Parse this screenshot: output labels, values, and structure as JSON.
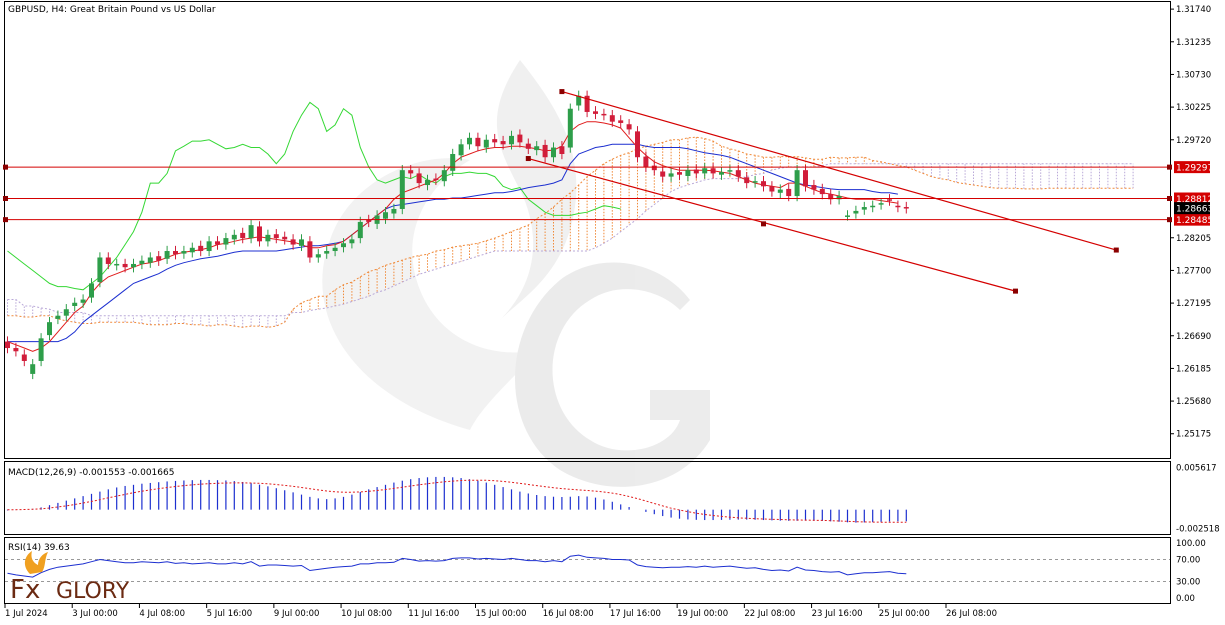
{
  "header": {
    "title": "GBPUSD, H4:  Great Britain Pound vs US Dollar"
  },
  "colors": {
    "bull": "#2e9e4a",
    "bear": "#d11d3a",
    "tenkan": "#e01c1c",
    "kijun": "#1c2fd0",
    "chikou": "#35d835",
    "cloud_a": "#f08a3a",
    "cloud_b": "#b9a8d8",
    "level_line": "#d40000",
    "macd_hist": "#1c2fd0",
    "macd_signal": "#e01c1c",
    "rsi_line": "#1c2fd0",
    "watermark": "#d4d4d4",
    "grid_text": "#000000"
  },
  "chart_data": {
    "type": "candlestick",
    "symbol": "GBPUSD",
    "timeframe": "H4",
    "ylim": [
      1.248,
      1.3185
    ],
    "yticks": [
      {
        "value": 1.3174,
        "label": "1.31740"
      },
      {
        "value": 1.31235,
        "label": "1.31235"
      },
      {
        "value": 1.3073,
        "label": "1.30730"
      },
      {
        "value": 1.30225,
        "label": "1.30225"
      },
      {
        "value": 1.2972,
        "label": "1.29720"
      },
      {
        "value": 1.28205,
        "label": "1.28205"
      },
      {
        "value": 1.277,
        "label": "1.27700"
      },
      {
        "value": 1.27195,
        "label": "1.27195"
      },
      {
        "value": 1.2669,
        "label": "1.26690"
      },
      {
        "value": 1.26185,
        "label": "1.26185"
      },
      {
        "value": 1.2568,
        "label": "1.25680"
      },
      {
        "value": 1.25175,
        "label": "1.25175"
      }
    ],
    "levels": [
      {
        "value": 1.29297,
        "label": "1.29297"
      },
      {
        "value": 1.28812,
        "label": "1.28812"
      },
      {
        "value": 1.28485,
        "label": "1.28485"
      }
    ],
    "current_price": {
      "value": 1.28663,
      "label": "1.28663"
    },
    "xticks": [
      "1 Jul 2024",
      "3 Jul 00:00",
      "4 Jul 08:00",
      "5 Jul 16:00",
      "9 Jul 00:00",
      "10 Jul 08:00",
      "11 Jul 16:00",
      "15 Jul 00:00",
      "16 Jul 08:00",
      "17 Jul 16:00",
      "19 Jul 00:00",
      "22 Jul 08:00",
      "23 Jul 16:00",
      "25 Jul 00:00",
      "26 Jul 08:00"
    ],
    "closes": [
      1.265,
      1.2645,
      1.263,
      1.2625,
      1.2665,
      1.269,
      1.27,
      1.271,
      1.272,
      1.2725,
      1.275,
      1.279,
      1.278,
      1.278,
      1.2775,
      1.278,
      1.2785,
      1.279,
      1.2785,
      1.28,
      1.2795,
      1.28,
      1.2805,
      1.28,
      1.2815,
      1.281,
      1.282,
      1.2825,
      1.282,
      1.284,
      1.2815,
      1.2825,
      1.282,
      1.2818,
      1.281,
      1.2818,
      1.279,
      1.2795,
      1.28,
      1.2805,
      1.2812,
      1.2818,
      1.2845,
      1.2845,
      1.2855,
      1.286,
      1.2865,
      1.2925,
      1.292,
      1.2905,
      1.291,
      1.291,
      1.2925,
      1.295,
      1.2965,
      1.2975,
      1.2962,
      1.2972,
      1.2968,
      1.2965,
      1.2978,
      1.2968,
      1.2958,
      1.2962,
      1.2945,
      1.296,
      1.295,
      1.302,
      1.304,
      1.3015,
      1.3012,
      1.301,
      1.3,
      1.2998,
      1.2988,
      1.2945,
      1.293,
      1.2925,
      1.2915,
      1.292,
      1.2918,
      1.2925,
      1.292,
      1.2928,
      1.292,
      1.2922,
      1.2925,
      1.2915,
      1.2905,
      1.2908,
      1.29,
      1.2892,
      1.2895,
      1.2885,
      1.2925,
      1.29,
      1.2895,
      1.2888,
      1.288,
      1.2885,
      1.2855,
      1.2862,
      1.2868,
      1.287,
      1.2874,
      1.2878,
      1.2868,
      1.2866
    ],
    "opens": [
      1.266,
      1.265,
      1.264,
      1.261,
      1.263,
      1.267,
      1.2695,
      1.27,
      1.2715,
      1.272,
      1.2728,
      1.2752,
      1.279,
      1.2778,
      1.278,
      1.2775,
      1.278,
      1.2782,
      1.2792,
      1.2788,
      1.28,
      1.2796,
      1.2798,
      1.2808,
      1.28,
      1.2815,
      1.281,
      1.2818,
      1.2828,
      1.282,
      1.2838,
      1.2815,
      1.2826,
      1.2822,
      1.2818,
      1.2808,
      1.2815,
      1.279,
      1.2796,
      1.28,
      1.2806,
      1.2812,
      1.282,
      1.2848,
      1.2842,
      1.285,
      1.2858,
      1.2865,
      1.2925,
      1.292,
      1.2902,
      1.2912,
      1.2908,
      1.2924,
      1.2948,
      1.2965,
      1.2975,
      1.296,
      1.2973,
      1.297,
      1.2965,
      1.298,
      1.2966,
      1.2956,
      1.2964,
      1.2945,
      1.2962,
      1.296,
      1.3025,
      1.304,
      1.3016,
      1.3012,
      1.301,
      1.3002,
      1.2996,
      1.2985,
      1.2946,
      1.2932,
      1.2923,
      1.2915,
      1.2922,
      1.2916,
      1.2926,
      1.292,
      1.2928,
      1.2918,
      1.2924,
      1.2925,
      1.2914,
      1.2906,
      1.2908,
      1.29,
      1.289,
      1.2896,
      1.2885,
      1.2925,
      1.2902,
      1.2896,
      1.2888,
      1.288,
      1.2855,
      1.2858,
      1.2864,
      1.2868,
      1.2872,
      1.288,
      1.287,
      1.2868
    ],
    "tenkan": [
      1.266,
      1.2655,
      1.265,
      1.2645,
      1.265,
      1.266,
      1.2675,
      1.269,
      1.2705,
      1.2715,
      1.2735,
      1.275,
      1.276,
      1.2765,
      1.277,
      1.2775,
      1.278,
      1.2782,
      1.2785,
      1.279,
      1.2795,
      1.2798,
      1.28,
      1.2802,
      1.2805,
      1.281,
      1.2812,
      1.2815,
      1.2818,
      1.282,
      1.2822,
      1.282,
      1.2818,
      1.2816,
      1.2814,
      1.281,
      1.2805,
      1.2805,
      1.2808,
      1.281,
      1.2815,
      1.2825,
      1.2835,
      1.2845,
      1.2855,
      1.2865,
      1.288,
      1.289,
      1.2895,
      1.29,
      1.2905,
      1.291,
      1.292,
      1.2935,
      1.2945,
      1.295,
      1.2955,
      1.2958,
      1.296,
      1.296,
      1.2962,
      1.2962,
      1.296,
      1.2958,
      1.2955,
      1.2956,
      1.2962,
      1.2985,
      1.2995,
      1.3,
      1.3,
      1.2998,
      1.2995,
      1.299,
      1.2975,
      1.296,
      1.2948,
      1.2938,
      1.2932,
      1.2928,
      1.2925,
      1.2925,
      1.2925,
      1.2925,
      1.2924,
      1.2922,
      1.292,
      1.2915,
      1.291,
      1.2905,
      1.2902,
      1.29,
      1.2898,
      1.2905,
      1.2905,
      1.29,
      1.2895,
      1.289,
      1.2888,
      1.2885,
      1.2882,
      1.288,
      1.288,
      1.288,
      1.2878,
      1.2876,
      1.2874
    ],
    "kijun": [
      1.266,
      1.266,
      1.266,
      1.266,
      1.266,
      1.266,
      1.266,
      1.2665,
      1.2675,
      1.269,
      1.27,
      1.271,
      1.272,
      1.273,
      1.274,
      1.275,
      1.2755,
      1.276,
      1.2765,
      1.2772,
      1.2778,
      1.2782,
      1.2785,
      1.2788,
      1.279,
      1.2792,
      1.2795,
      1.2798,
      1.28,
      1.28,
      1.28,
      1.28,
      1.28,
      1.2802,
      1.2804,
      1.2806,
      1.2808,
      1.2808,
      1.281,
      1.2812,
      1.2815,
      1.2825,
      1.2835,
      1.2845,
      1.2855,
      1.2865,
      1.287,
      1.2872,
      1.2874,
      1.2876,
      1.2878,
      1.288,
      1.288,
      1.2882,
      1.2882,
      1.2884,
      1.2886,
      1.2888,
      1.289,
      1.289,
      1.2892,
      1.2895,
      1.2898,
      1.29,
      1.2902,
      1.2905,
      1.291,
      1.2935,
      1.295,
      1.2955,
      1.296,
      1.2962,
      1.2965,
      1.2965,
      1.2965,
      1.2965,
      1.2962,
      1.296,
      1.296,
      1.296,
      1.296,
      1.2958,
      1.2955,
      1.2952,
      1.295,
      1.2948,
      1.2945,
      1.294,
      1.2935,
      1.293,
      1.2925,
      1.292,
      1.2915,
      1.291,
      1.2905,
      1.2902,
      1.29,
      1.2898,
      1.2896,
      1.2895,
      1.2895,
      1.2895,
      1.2895,
      1.2892,
      1.289,
      1.289,
      1.2888
    ],
    "chikou": [
      1.28,
      1.279,
      1.278,
      1.277,
      1.276,
      1.275,
      1.2745,
      1.2745,
      1.2742,
      1.274,
      1.275,
      1.276,
      1.2775,
      1.279,
      1.281,
      1.283,
      1.286,
      1.2905,
      1.2905,
      1.292,
      1.2955,
      1.2962,
      1.297,
      1.297,
      1.2972,
      1.2965,
      1.2958,
      1.296,
      1.2965,
      1.296,
      1.296,
      1.295,
      1.2935,
      1.295,
      1.2985,
      1.301,
      1.303,
      1.302,
      1.2985,
      1.2995,
      1.302,
      1.301,
      1.296,
      1.293,
      1.291,
      1.2905,
      1.291,
      1.2915,
      1.2912,
      1.2918,
      1.291,
      1.2905,
      1.2915,
      1.292,
      1.292,
      1.2922,
      1.292,
      1.292,
      1.2915,
      1.29,
      1.2895,
      1.2898,
      1.288,
      1.287,
      1.286,
      1.2855,
      1.2855,
      1.2855,
      1.2858,
      1.286,
      1.2865,
      1.287,
      1.2868,
      1.2865
    ],
    "span_a": [
      1.27,
      1.27,
      1.2698,
      1.2698,
      1.27,
      1.27,
      1.2695,
      1.2692,
      1.269,
      1.2688,
      1.2688,
      1.269,
      1.269,
      1.269,
      1.269,
      1.269,
      1.2688,
      1.2686,
      1.2686,
      1.2686,
      1.2688,
      1.2688,
      1.2686,
      1.2686,
      1.2684,
      1.2686,
      1.2686,
      1.2684,
      1.2682,
      1.2684,
      1.2684,
      1.2682,
      1.2684,
      1.269,
      1.271,
      1.272,
      1.2725,
      1.273,
      1.273,
      1.274,
      1.2748,
      1.2752,
      1.276,
      1.2768,
      1.2772,
      1.2778,
      1.2782,
      1.2786,
      1.279,
      1.2793,
      1.2795,
      1.28,
      1.2802,
      1.2806,
      1.2808,
      1.281,
      1.2812,
      1.2816,
      1.282,
      1.2825,
      1.283,
      1.2835,
      1.284,
      1.285,
      1.2858,
      1.2868,
      1.288,
      1.289,
      1.2902,
      1.2915,
      1.2925,
      1.2935,
      1.2942,
      1.2948,
      1.2952,
      1.2958,
      1.2962,
      1.2965,
      1.2968,
      1.2972,
      1.2972,
      1.2975,
      1.2976,
      1.2974,
      1.297,
      1.2962,
      1.2958,
      1.2955,
      1.295,
      1.2948,
      1.2945,
      1.2945,
      1.2946,
      1.2946,
      1.2946,
      1.2944,
      1.2942,
      1.2942,
      1.2945,
      1.2944,
      1.2944,
      1.2945,
      1.2945,
      1.294,
      1.2938,
      1.2935,
      1.2932,
      1.293,
      1.2925,
      1.292,
      1.2915,
      1.2912,
      1.291,
      1.2906,
      1.2904,
      1.2902,
      1.29,
      1.2898,
      1.2897,
      1.2897,
      1.2897,
      1.2896,
      1.2896,
      1.2896,
      1.2897,
      1.2897,
      1.2897,
      1.2897,
      1.2897,
      1.2897,
      1.2897,
      1.2897,
      1.2897,
      1.2897,
      1.2897
    ],
    "span_b": [
      1.2725,
      1.2725,
      1.2715,
      1.2715,
      1.2712,
      1.271,
      1.2705,
      1.2705,
      1.2705,
      1.2705,
      1.27,
      1.27,
      1.27,
      1.27,
      1.27,
      1.27,
      1.27,
      1.27,
      1.27,
      1.27,
      1.27,
      1.27,
      1.27,
      1.27,
      1.27,
      1.27,
      1.27,
      1.27,
      1.27,
      1.27,
      1.27,
      1.27,
      1.27,
      1.27,
      1.2705,
      1.2705,
      1.2708,
      1.271,
      1.2712,
      1.2715,
      1.2718,
      1.2722,
      1.2726,
      1.273,
      1.2736,
      1.274,
      1.2746,
      1.2752,
      1.2758,
      1.2764,
      1.2768,
      1.2772,
      1.2776,
      1.278,
      1.2784,
      1.2788,
      1.2792,
      1.2796,
      1.28,
      1.28,
      1.28,
      1.28,
      1.28,
      1.28,
      1.28,
      1.28,
      1.28,
      1.28,
      1.28,
      1.28,
      1.2805,
      1.2812,
      1.282,
      1.283,
      1.284,
      1.285,
      1.2862,
      1.2872,
      1.2882,
      1.2892,
      1.2898,
      1.2902,
      1.2906,
      1.291,
      1.2912,
      1.2912,
      1.2912,
      1.2912,
      1.2915,
      1.2918,
      1.292,
      1.2925,
      1.2928,
      1.293,
      1.293,
      1.293,
      1.293,
      1.2932,
      1.2935,
      1.2935,
      1.2935,
      1.2935,
      1.2935,
      1.2935,
      1.2935,
      1.2935,
      1.2935,
      1.2935,
      1.2935,
      1.2935,
      1.2935,
      1.2935,
      1.2935,
      1.2935,
      1.2935,
      1.2935,
      1.2935,
      1.2935,
      1.2935,
      1.2935,
      1.2935,
      1.2935,
      1.2935,
      1.2935,
      1.2935,
      1.2935,
      1.2935,
      1.2935,
      1.2935,
      1.2935,
      1.2935,
      1.2935,
      1.2935,
      1.2935,
      1.2935
    ],
    "channel": {
      "upper": {
        "start_bar": 66,
        "start_price": 1.30465,
        "end_bar": 132,
        "end_price": 1.28015
      },
      "lower": {
        "start_bar": 62,
        "start_price": 1.2943,
        "end_bar": 120,
        "end_price": 1.2738
      },
      "touch_points": [
        {
          "bar": 90,
          "price": 1.2842
        }
      ]
    },
    "macd": {
      "label": "MACD(12,26,9) -0.001553 -0.001665",
      "ylim": [
        -0.0031,
        0.0062
      ],
      "yticks": [
        {
          "value": 0.005617,
          "label": "0.005617"
        },
        {
          "value": -0.002518,
          "label": "-0.002518"
        }
      ],
      "histogram": [
        -0.0001,
        -5e-05,
        0.0,
        0.0001,
        0.0003,
        0.0006,
        0.0009,
        0.0012,
        0.0015,
        0.0018,
        0.0021,
        0.0024,
        0.0027,
        0.00295,
        0.00315,
        0.0033,
        0.00345,
        0.00355,
        0.00365,
        0.00375,
        0.00382,
        0.00388,
        0.00392,
        0.00395,
        0.00395,
        0.00392,
        0.00388,
        0.0038,
        0.00368,
        0.00352,
        0.00332,
        0.0031,
        0.00285,
        0.00258,
        0.0023,
        0.002,
        0.0017,
        0.0015,
        0.0014,
        0.0015,
        0.0017,
        0.002,
        0.00235,
        0.0027,
        0.003,
        0.0033,
        0.0036,
        0.00385,
        0.00405,
        0.0042,
        0.0043,
        0.00435,
        0.00435,
        0.0043,
        0.0042,
        0.00405,
        0.00385,
        0.0036,
        0.0033,
        0.003,
        0.0027,
        0.0024,
        0.00215,
        0.00195,
        0.0018,
        0.00172,
        0.00168,
        0.00172,
        0.0018,
        0.00175,
        0.0016,
        0.00135,
        0.00105,
        0.0007,
        0.00035,
        0.0,
        -0.0003,
        -0.0006,
        -0.00085,
        -0.00105,
        -0.0012,
        -0.0013,
        -0.00135,
        -0.00138,
        -0.00138,
        -0.00136,
        -0.00134,
        -0.00132,
        -0.00132,
        -0.00134,
        -0.00138,
        -0.00142,
        -0.00146,
        -0.00148,
        -0.00148,
        -0.00146,
        -0.00148,
        -0.0015,
        -0.00155,
        -0.0016,
        -0.00168,
        -0.00172,
        -0.0017,
        -0.00166,
        -0.00162,
        -0.00158,
        -0.00155,
        -0.00155
      ],
      "signal": [
        0.0,
        0.0,
        2e-05,
        6e-05,
        0.00012,
        0.00022,
        0.00035,
        0.0005,
        0.00068,
        0.00088,
        0.0011,
        0.00133,
        0.00157,
        0.0018,
        0.00203,
        0.00225,
        0.00245,
        0.00263,
        0.0028,
        0.00295,
        0.00308,
        0.0032,
        0.0033,
        0.00338,
        0.00345,
        0.0035,
        0.00354,
        0.00356,
        0.00356,
        0.00354,
        0.0035,
        0.00343,
        0.00334,
        0.00323,
        0.0031,
        0.00295,
        0.00278,
        0.00262,
        0.00248,
        0.00238,
        0.00232,
        0.00232,
        0.00236,
        0.00244,
        0.00255,
        0.00268,
        0.00283,
        0.00298,
        0.00314,
        0.0033,
        0.00345,
        0.00358,
        0.0037,
        0.0038,
        0.00387,
        0.00391,
        0.00392,
        0.0039,
        0.00385,
        0.00376,
        0.00364,
        0.0035,
        0.00335,
        0.0032,
        0.00305,
        0.00292,
        0.0028,
        0.0027,
        0.00262,
        0.00255,
        0.00247,
        0.00235,
        0.0022,
        0.002,
        0.00175,
        0.00147,
        0.00115,
        0.00082,
        0.0005,
        0.0002,
        -5e-05,
        -0.00027,
        -0.00047,
        -0.00064,
        -0.00078,
        -0.0009,
        -0.001,
        -0.00108,
        -0.00115,
        -0.0012,
        -0.00124,
        -0.00128,
        -0.00131,
        -0.00134,
        -0.00137,
        -0.00139,
        -0.00141,
        -0.00143,
        -0.00146,
        -0.0015,
        -0.00155,
        -0.0016,
        -0.00163,
        -0.00165,
        -0.00166,
        -0.00166,
        -0.00166,
        -0.00166
      ]
    },
    "rsi": {
      "label": "RSI(14) 39.63",
      "ylim": [
        0,
        100
      ],
      "levels": [
        70,
        30
      ],
      "yticks": [
        {
          "value": 100,
          "label": "100.00"
        },
        {
          "value": 70,
          "label": "70.00"
        },
        {
          "value": 30,
          "label": "30.00"
        },
        {
          "value": 0,
          "label": "0.00"
        }
      ],
      "values": [
        45,
        42,
        40,
        38,
        46,
        52,
        56,
        58,
        60,
        62,
        66,
        70,
        68,
        66,
        64,
        64,
        66,
        65,
        64,
        66,
        63,
        64,
        62,
        63,
        64,
        62,
        62,
        64,
        62,
        66,
        58,
        60,
        60,
        59,
        58,
        59,
        50,
        52,
        54,
        56,
        57,
        58,
        62,
        62,
        64,
        64,
        65,
        72,
        70,
        67,
        68,
        67,
        68,
        72,
        73,
        73,
        71,
        72,
        71,
        70,
        72,
        70,
        68,
        68,
        66,
        68,
        66,
        76,
        78,
        74,
        73,
        72,
        70,
        70,
        69,
        60,
        57,
        56,
        55,
        56,
        56,
        57,
        56,
        58,
        56,
        57,
        58,
        56,
        54,
        55,
        52,
        50,
        51,
        49,
        56,
        51,
        50,
        48,
        47,
        48,
        42,
        44,
        46,
        46,
        47,
        48,
        45,
        44
      ]
    }
  },
  "watermark": {
    "brand": "FxGlory"
  },
  "logo": {
    "text": "FxGlory",
    "part_fx": "Fx",
    "part_glory": "GLORY"
  }
}
